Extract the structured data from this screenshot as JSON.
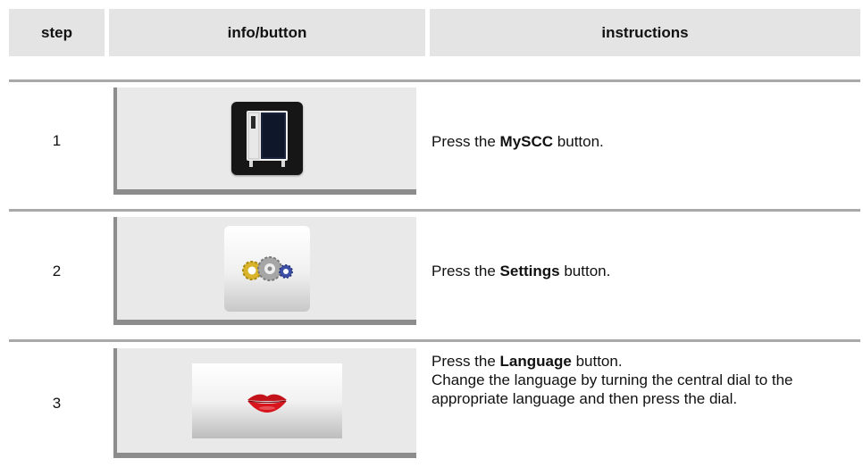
{
  "header": {
    "step": "step",
    "info": "info/button",
    "instructions": "instructions"
  },
  "rows": [
    {
      "step": "1",
      "icon": "oven-icon",
      "pre": "Press the ",
      "bold": "MySCC",
      "post": " button.",
      "extra": ""
    },
    {
      "step": "2",
      "icon": "settings-gears-icon",
      "pre": "Press the ",
      "bold": "Settings",
      "post": " button.",
      "extra": ""
    },
    {
      "step": "3",
      "icon": "lips-icon",
      "pre": "Press the ",
      "bold": "Language",
      "post": " button.",
      "extra": "Change the language by turning the central dial to the appropriate language and then press the dial."
    }
  ],
  "colors": {
    "header_bg": "#e4e4e4",
    "cell_bg": "#e9e9e9",
    "cell_border": "#8c8c8c",
    "rule": "#a9a9a9",
    "lips": "#d4141c"
  }
}
